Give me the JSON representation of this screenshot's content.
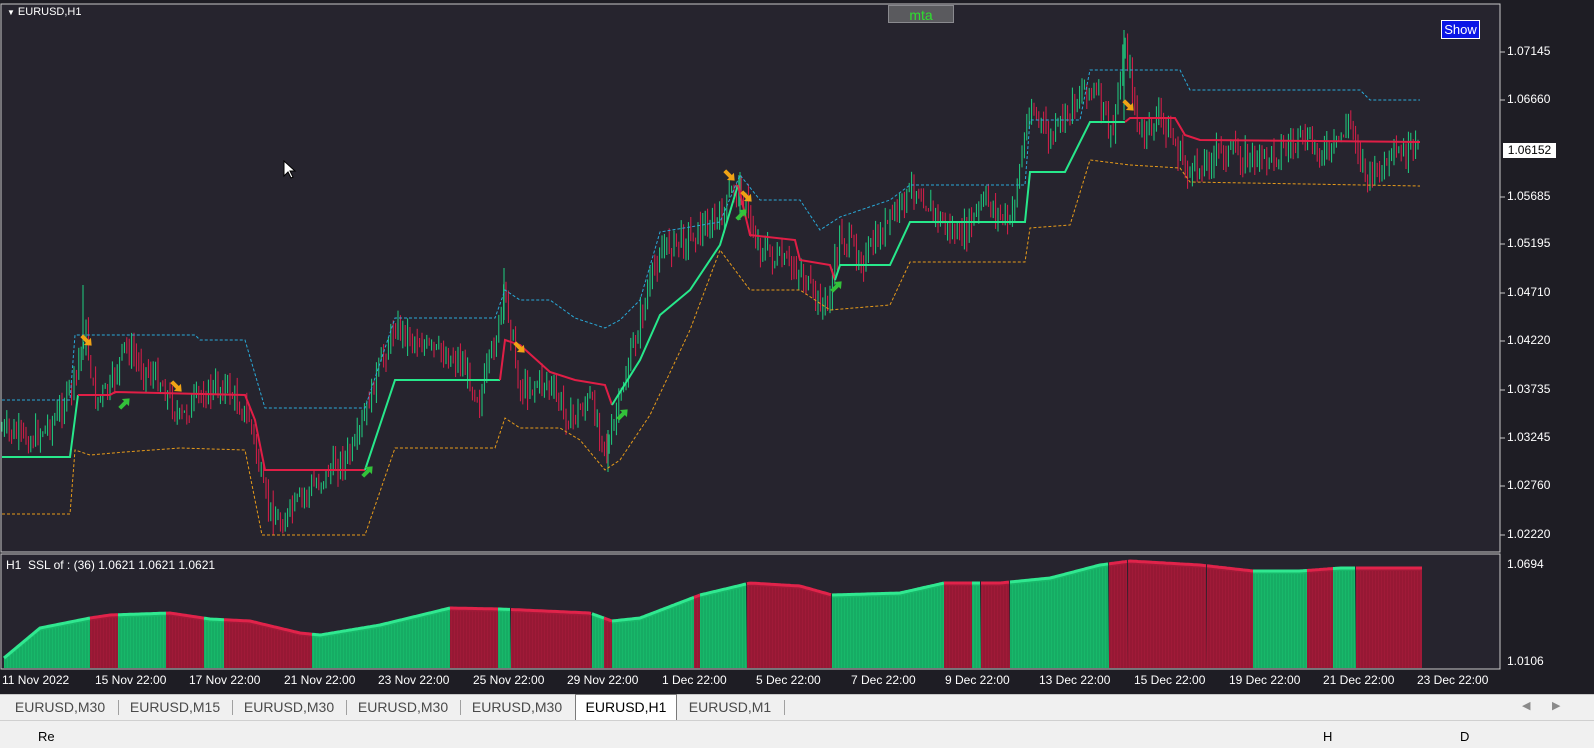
{
  "chart": {
    "symbol_title": "EURUSD,H1",
    "mta_button": "mta",
    "show_button": "Show",
    "current_price": "1.06152",
    "price_axis": [
      "1.07145",
      "1.06660",
      "1.05685",
      "1.05195",
      "1.04710",
      "1.04220",
      "1.03735",
      "1.03245",
      "1.02760",
      "1.02220"
    ],
    "subwindow_label": "H1  SSL of : (36) 1.0621 1.0621 1.0621",
    "sub_axis": [
      "1.0694",
      "1.0106"
    ],
    "date_axis": [
      "11 Nov 2022",
      "15 Nov 22:00",
      "17 Nov 22:00",
      "21 Nov 22:00",
      "23 Nov 22:00",
      "25 Nov 22:00",
      "29 Nov 22:00",
      "1 Dec 22:00",
      "5 Dec 22:00",
      "7 Dec 22:00",
      "9 Dec 22:00",
      "13 Dec 22:00",
      "15 Dec 22:00",
      "19 Dec 22:00",
      "21 Dec 22:00",
      "23 Dec 22:00"
    ],
    "colors": {
      "background": "#24222c",
      "bull": "#1fcf80",
      "bear": "#dc1e4a",
      "ssl_up": "#27e88b",
      "ssl_down": "#e01e46",
      "upper_band": "#29a9d8",
      "lower_band": "#e59a1a",
      "arrow_up": "#33c23a",
      "arrow_down": "#f0a315"
    }
  },
  "tabs": [
    {
      "label": "EURUSD,M30",
      "active": false
    },
    {
      "label": "EURUSD,M15",
      "active": false
    },
    {
      "label": "EURUSD,M30",
      "active": false
    },
    {
      "label": "EURUSD,M30",
      "active": false
    },
    {
      "label": "EURUSD,M30",
      "active": false
    },
    {
      "label": "EURUSD,H1",
      "active": true
    },
    {
      "label": "EURUSD,M1",
      "active": false
    }
  ],
  "status": {
    "left": "Re",
    "mid": "H",
    "right": "D"
  },
  "icons": [
    "dropdown-triangle-icon",
    "scroll-left-icon",
    "scroll-right-icon",
    "mouse-cursor-icon"
  ]
}
